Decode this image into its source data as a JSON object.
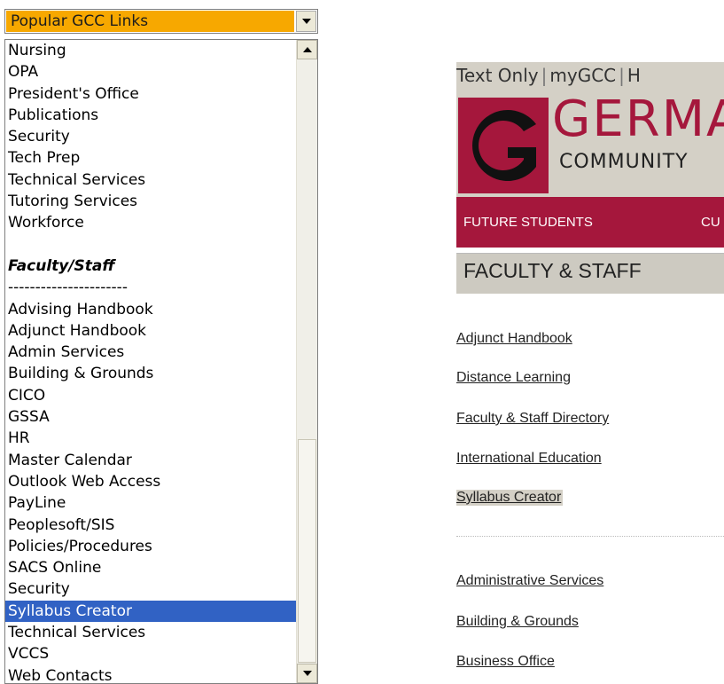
{
  "dropdown": {
    "selected": "Popular GCC Links"
  },
  "list": {
    "items": [
      {
        "label": "Nursing"
      },
      {
        "label": "OPA"
      },
      {
        "label": "President's Office"
      },
      {
        "label": "Publications"
      },
      {
        "label": "Security"
      },
      {
        "label": "Tech Prep"
      },
      {
        "label": "Technical Services"
      },
      {
        "label": "Tutoring Services"
      },
      {
        "label": "Workforce"
      },
      {
        "label": ""
      },
      {
        "label": "Faculty/Staff"
      },
      {
        "label": "----------------------"
      },
      {
        "label": "Advising Handbook"
      },
      {
        "label": "Adjunct Handbook"
      },
      {
        "label": "Admin Services"
      },
      {
        "label": "Building & Grounds"
      },
      {
        "label": "CICO"
      },
      {
        "label": "GSSA"
      },
      {
        "label": "HR"
      },
      {
        "label": "Master Calendar"
      },
      {
        "label": "Outlook Web Access"
      },
      {
        "label": "PayLine"
      },
      {
        "label": "Peoplesoft/SIS"
      },
      {
        "label": "Policies/Procedures"
      },
      {
        "label": "SACS Online"
      },
      {
        "label": "Security"
      },
      {
        "label": "Syllabus Creator"
      },
      {
        "label": "Technical Services"
      },
      {
        "label": "VCCS"
      },
      {
        "label": "Web Contacts"
      }
    ]
  },
  "page": {
    "topnav": {
      "text_only": "Text Only",
      "sep": "|",
      "mygcc": "myGCC",
      "home_partial": "H"
    },
    "logo": {
      "word": "GERMA",
      "sub": "COMMUNITY"
    },
    "navbar": {
      "future_students": "FUTURE STUDENTS",
      "current_partial": "CU"
    },
    "section_title": "FACULTY & STAFF",
    "links_group1": [
      "Adjunct Handbook",
      "Distance Learning",
      "Faculty & Staff Directory",
      "International Education",
      "Syllabus Creator"
    ],
    "links_group2": [
      "Administrative Services",
      "Building & Grounds",
      "Business Office"
    ]
  },
  "colors": {
    "select_highlight": "#f7a800",
    "list_selection": "#3162c4",
    "brand_maroon": "#a5173c",
    "band_gray": "#d4d0c6"
  }
}
